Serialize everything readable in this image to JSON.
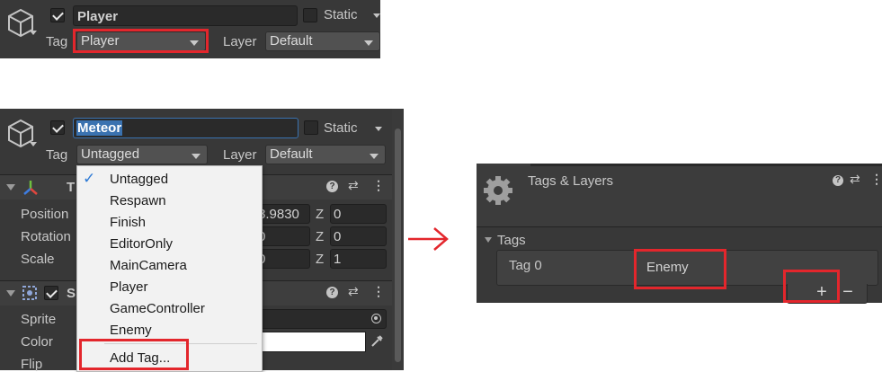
{
  "top": {
    "name": "Player",
    "static_label": "Static",
    "tag_label": "Tag",
    "tag_value": "Player",
    "layer_label": "Layer",
    "layer_value": "Default"
  },
  "mid": {
    "name": "Meteor",
    "static_label": "Static",
    "tag_label": "Tag",
    "tag_value": "Untagged",
    "layer_label": "Layer",
    "layer_value": "Default",
    "transform": {
      "section_initial": "T",
      "rows": [
        {
          "label": "Position",
          "x_value": "8.9830",
          "z_label": "Z",
          "z_value": "0"
        },
        {
          "label": "Rotation",
          "x_value": "0",
          "z_label": "Z",
          "z_value": "0"
        },
        {
          "label": "Scale",
          "x_value": "0",
          "z_label": "Z",
          "z_value": "1"
        }
      ]
    },
    "sprite": {
      "section_initial": "S",
      "rows": [
        {
          "label": "Sprite"
        },
        {
          "label": "Color"
        },
        {
          "label": "Flip"
        }
      ]
    }
  },
  "tag_menu": {
    "items": [
      "Untagged",
      "Respawn",
      "Finish",
      "EditorOnly",
      "MainCamera",
      "Player",
      "GameController",
      "Enemy"
    ],
    "checked_item": "Untagged",
    "add_tag": "Add Tag..."
  },
  "tags_layers": {
    "title": "Tags & Layers",
    "tags_header": "Tags",
    "tag_row_label": "Tag 0",
    "tag_row_value": "Enemy",
    "add_symbol": "+",
    "remove_symbol": "−"
  },
  "colors": {
    "panel_bg": "#383838",
    "highlight_red": "#e3262c",
    "selection_blue": "#3a72b0",
    "menu_check_blue": "#2f7bd6"
  },
  "icons": [
    "cube-icon",
    "transform-axes-icon",
    "sprite-icon",
    "gear-icon",
    "help-icon",
    "preset-icon",
    "kebab-icon",
    "eyedropper-icon",
    "object-picker-icon",
    "arrow-right-icon"
  ]
}
